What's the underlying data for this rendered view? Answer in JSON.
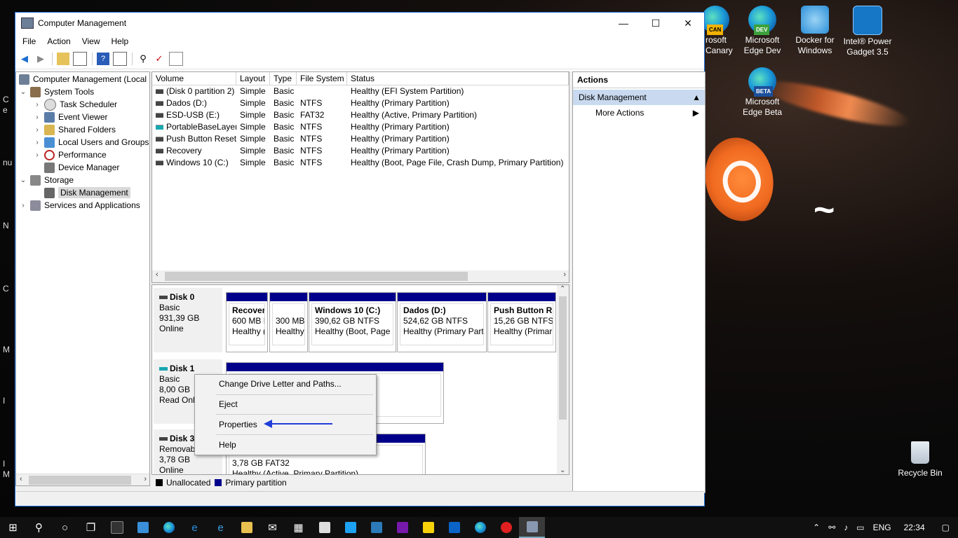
{
  "window": {
    "title": "Computer Management",
    "minimize": "—",
    "maximize": "☐",
    "close": "✕"
  },
  "menu": [
    "File",
    "Action",
    "View",
    "Help"
  ],
  "tree": {
    "root": "Computer Management (Local",
    "system_tools": "System Tools",
    "task_scheduler": "Task Scheduler",
    "event_viewer": "Event Viewer",
    "shared_folders": "Shared Folders",
    "local_users": "Local Users and Groups",
    "performance": "Performance",
    "device_manager": "Device Manager",
    "storage": "Storage",
    "disk_management": "Disk Management",
    "services": "Services and Applications"
  },
  "volume_columns": [
    "Volume",
    "Layout",
    "Type",
    "File System",
    "Status"
  ],
  "volumes": [
    {
      "name": "(Disk 0 partition 2)",
      "layout": "Simple",
      "type": "Basic",
      "fs": "",
      "status": "Healthy (EFI System Partition)"
    },
    {
      "name": "Dados (D:)",
      "layout": "Simple",
      "type": "Basic",
      "fs": "NTFS",
      "status": "Healthy (Primary Partition)"
    },
    {
      "name": "ESD-USB (E:)",
      "layout": "Simple",
      "type": "Basic",
      "fs": "FAT32",
      "status": "Healthy (Active, Primary Partition)"
    },
    {
      "name": "PortableBaseLayer",
      "layout": "Simple",
      "type": "Basic",
      "fs": "NTFS",
      "status": "Healthy (Primary Partition)"
    },
    {
      "name": "Push Button Reset",
      "layout": "Simple",
      "type": "Basic",
      "fs": "NTFS",
      "status": "Healthy (Primary Partition)"
    },
    {
      "name": "Recovery",
      "layout": "Simple",
      "type": "Basic",
      "fs": "NTFS",
      "status": "Healthy (Primary Partition)"
    },
    {
      "name": "Windows 10 (C:)",
      "layout": "Simple",
      "type": "Basic",
      "fs": "NTFS",
      "status": "Healthy (Boot, Page File, Crash Dump, Primary Partition)"
    }
  ],
  "disk0": {
    "name": "Disk 0",
    "kind": "Basic",
    "size": "931,39 GB",
    "state": "Online",
    "parts": [
      {
        "title": "Recover",
        "l1": "600 MB N",
        "l2": "Healthy ("
      },
      {
        "title": "",
        "l1": "300 MB",
        "l2": "Healthy"
      },
      {
        "title": "Windows 10  (C:)",
        "l1": "390,62 GB NTFS",
        "l2": "Healthy (Boot, Page F"
      },
      {
        "title": "Dados  (D:)",
        "l1": "524,62 GB NTFS",
        "l2": "Healthy (Primary Part"
      },
      {
        "title": "Push Button Re",
        "l1": "15,26 GB NTFS",
        "l2": "Healthy (Primar"
      }
    ]
  },
  "disk1": {
    "name": "Disk 1",
    "kind": "Basic",
    "size": "8,00 GB",
    "state": "Read Only"
  },
  "disk3": {
    "name": "Disk 3",
    "kind": "Removabl",
    "size": "3,78 GB",
    "state": "Online",
    "p_l1": "3,78 GB FAT32",
    "p_l2": "Healthy (Active, Primary Partition)"
  },
  "legend": {
    "unallocated": "Unallocated",
    "primary": "Primary partition"
  },
  "actions": {
    "header": "Actions",
    "section": "Disk Management",
    "more": "More Actions"
  },
  "context_menu": [
    "Change Drive Letter and Paths...",
    "Eject",
    "Properties",
    "Help"
  ],
  "desktop_icons": {
    "canary": "rosoft\nCanary",
    "edge_dev": "Microsoft Edge Dev",
    "docker": "Docker for Windows",
    "intel": "Intel® Power Gadget 3.5",
    "edge_beta": "Microsoft Edge Beta",
    "recycle": "Recycle Bin",
    "badge_can": "CAN",
    "badge_dev": "DEV",
    "badge_beta": "BETA"
  },
  "tray": {
    "lang": "ENG",
    "time": "22:34"
  },
  "colors": {
    "primary_partition": "#00008b",
    "selection": "#c9daf0",
    "arrow": "#1f3fd8"
  }
}
